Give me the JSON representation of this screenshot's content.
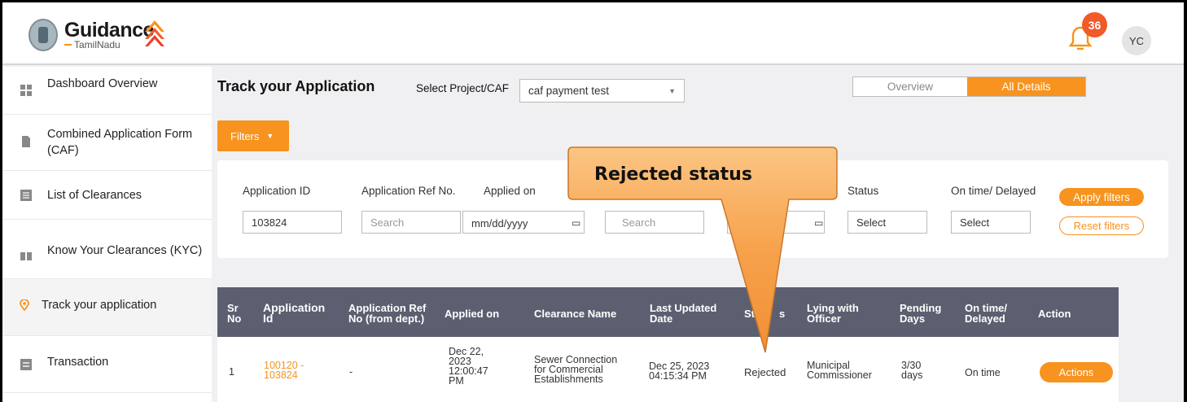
{
  "header": {
    "logo_main": "Guidance",
    "logo_sub": "TamilNadu",
    "notification_count": "36",
    "user_initials": "YC"
  },
  "sidebar": {
    "items": [
      {
        "label": "Dashboard Overview",
        "icon": "dashboard-grid-icon"
      },
      {
        "label": "Combined Application Form (CAF)",
        "icon": "document-icon"
      },
      {
        "label": "List of Clearances",
        "icon": "list-icon"
      },
      {
        "label": "Know Your Clearances (KYC)",
        "icon": "book-icon"
      },
      {
        "label": "Track your application",
        "icon": "location-pin-icon"
      },
      {
        "label": "Transaction",
        "icon": "transaction-icon"
      }
    ]
  },
  "main": {
    "title": "Track your Application",
    "project_label": "Select Project/CAF",
    "project_value": "caf payment test",
    "view_tabs": [
      "Overview",
      "All Details"
    ],
    "filters_label": "Filters",
    "filters": {
      "application_id_label": "Application ID",
      "application_id_value": "103824",
      "ref_no_label": "Application Ref No.",
      "ref_no_placeholder": "Search",
      "applied_on_label": "Applied on",
      "applied_on_placeholder": "mm/dd/yyyy",
      "clearance_placeholder": "Search",
      "status_label": "Status",
      "status_placeholder": "Select",
      "ontime_label": "On time/ Delayed",
      "ontime_placeholder": "Select",
      "apply_label": "Apply filters",
      "reset_label": "Reset filters"
    },
    "table": {
      "headers": {
        "sr": "Sr\nNo",
        "app_id": "Application\nId",
        "ref": "Application Ref\nNo (from dept.)",
        "applied": "Applied on",
        "clearance": "Clearance Name",
        "updated": "Last Updated\nDate",
        "status": "St",
        "status_tail": "s",
        "officer": "Lying with\nOfficer",
        "pending": "Pending\nDays",
        "ontime": "On time/\nDelayed",
        "action": "Action"
      },
      "rows": [
        {
          "sr": "1",
          "app_id": "100120 -\n103824",
          "ref": "-",
          "applied": "Dec 22,\n2023\n12:00:47\nPM",
          "clearance": "Sewer Connection\nfor Commercial\nEstablishments",
          "updated": "Dec 25, 2023\n04:15:34 PM",
          "status": "Rejected",
          "officer": "Municipal\nCommissioner",
          "pending": "3/30\ndays",
          "ontime": "On time",
          "action": "Actions"
        }
      ]
    }
  },
  "callout": {
    "text": "Rejected status",
    "fill_color": "#f7a24c"
  },
  "colors": {
    "accent": "#f7931e",
    "badge": "#f15a29",
    "table_header": "#5c5f70"
  }
}
